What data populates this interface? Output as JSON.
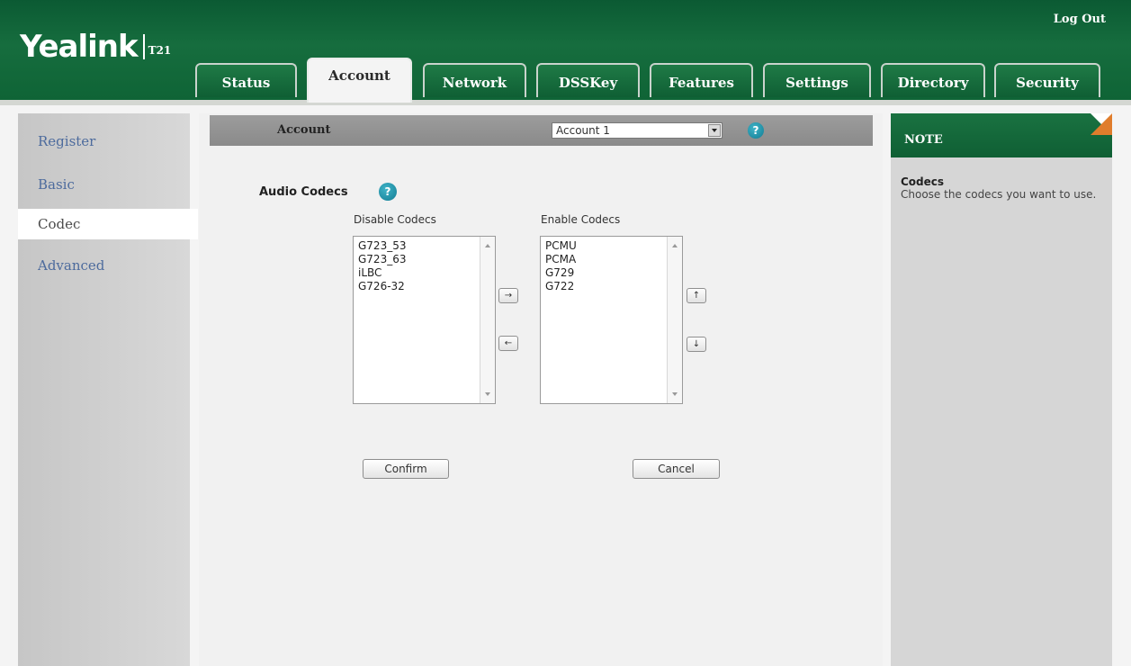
{
  "header": {
    "logo": "Yealink",
    "model": "T21",
    "logout": "Log Out",
    "tabs": [
      {
        "label": "Status"
      },
      {
        "label": "Account"
      },
      {
        "label": "Network"
      },
      {
        "label": "DSSKey"
      },
      {
        "label": "Features"
      },
      {
        "label": "Settings"
      },
      {
        "label": "Directory"
      },
      {
        "label": "Security"
      }
    ],
    "active_tab": "Account"
  },
  "sidebar": {
    "items": [
      {
        "label": "Register"
      },
      {
        "label": "Basic"
      },
      {
        "label": "Codec"
      },
      {
        "label": "Advanced"
      }
    ],
    "active_item": "Codec"
  },
  "account_bar": {
    "label": "Account",
    "selected": "Account 1"
  },
  "codecs": {
    "title": "Audio Codecs",
    "disabled_label": "Disable Codecs",
    "enabled_label": "Enable Codecs",
    "disabled": [
      "G723_53",
      "G723_63",
      "iLBC",
      "G726-32"
    ],
    "enabled": [
      "PCMU",
      "PCMA",
      "G729",
      "G722"
    ],
    "move_right": "→",
    "move_left": "←",
    "move_up": "↑",
    "move_down": "↓"
  },
  "actions": {
    "confirm": "Confirm",
    "cancel": "Cancel"
  },
  "note": {
    "header": "NOTE",
    "title": "Codecs",
    "text": "Choose the codecs you want to use."
  },
  "colors": {
    "brand_green": "#0f6436",
    "link_blue": "#4d6b9d",
    "help_teal": "#1a8aa0",
    "note_corner": "#e07d2c"
  },
  "icons": {
    "help": "help-icon",
    "dropdown": "chevron-down-icon"
  }
}
